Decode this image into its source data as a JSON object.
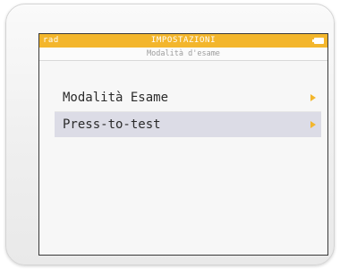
{
  "status_bar": {
    "mode": "rad",
    "title": "IMPOSTAZIONI",
    "battery_icon": "battery-icon",
    "color": "#f3b62c"
  },
  "subtitle": "Modalità d'esame",
  "menu": {
    "items": [
      {
        "label": "Modalità Esame",
        "selected": false,
        "icon": "chevron-right-icon"
      },
      {
        "label": "Press-to-test",
        "selected": true,
        "icon": "chevron-right-icon"
      }
    ]
  },
  "colors": {
    "accent": "#f3b62c",
    "selection": "#dcdce6"
  }
}
